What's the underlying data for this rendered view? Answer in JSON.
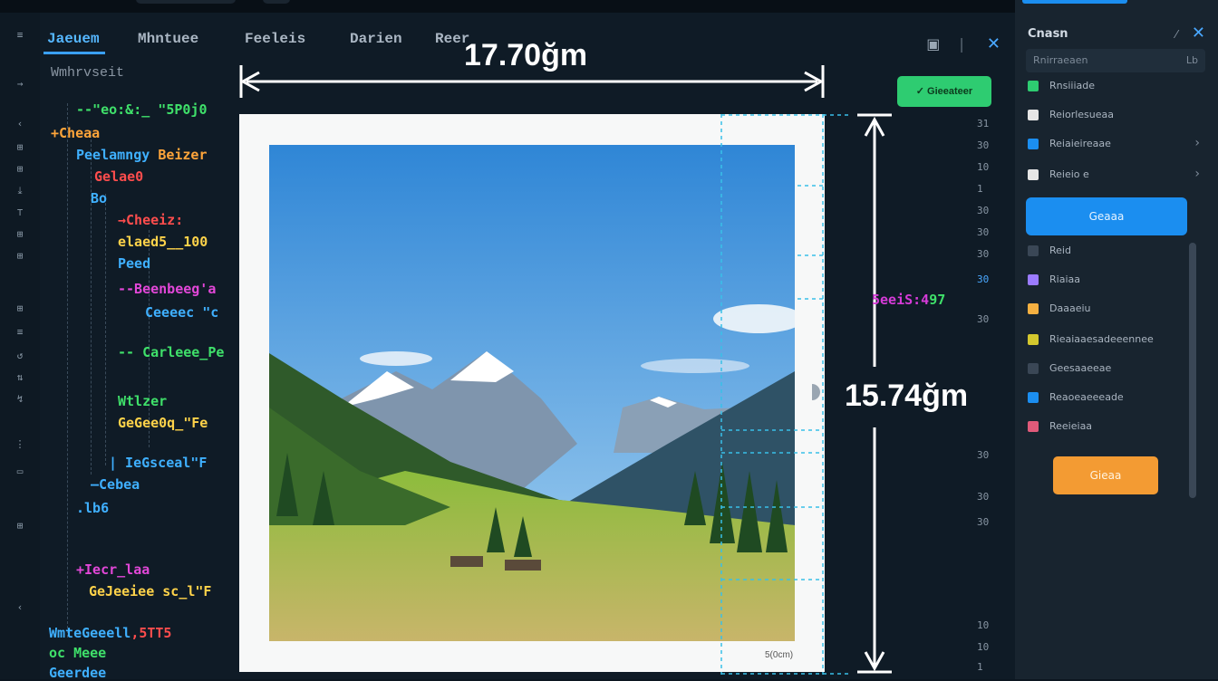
{
  "window": {
    "tabs": [
      {
        "label": "Jaeuem",
        "active": true
      },
      {
        "label": "Mhntuee",
        "active": false
      },
      {
        "label": "Feeleis",
        "active": false
      },
      {
        "label": "Darien",
        "active": false
      },
      {
        "label": "Reer",
        "active": false
      }
    ],
    "breadcrumb": "Wmhrvseit"
  },
  "gutter_icons": [
    "≡",
    "→",
    "‹",
    "⊞",
    "⊞",
    "⤓",
    "⊤",
    "⊞",
    "⊞",
    "⊞",
    "≡",
    "↺",
    "⇅",
    "↯",
    "⋮",
    "▭",
    "⊞",
    "‹"
  ],
  "code": {
    "lines": [
      {
        "text": "--\"eo:&:_ \"5P0j0",
        "color": "#3fe06a"
      },
      {
        "text": "+Cheaa",
        "color": "#ffa53a"
      },
      {
        "text": "Peelamngy ",
        "color": "#3fb0ff",
        "extra": "Beizer",
        "extra_color": "#ffa53a"
      },
      {
        "text": "Gelae0",
        "color": "#ff4d4d"
      },
      {
        "text": "Bo",
        "color": "#3fb0ff"
      },
      {
        "text": "→Cheeiz:",
        "color": "#ff4d4d"
      },
      {
        "text": "elaed5__100",
        "color": "#ffd34a"
      },
      {
        "text": "Peed",
        "color": "#3fb0ff"
      },
      {
        "text": "--Beenbeeg'a",
        "color": "#e247d8"
      },
      {
        "text": "Ceeeec \"c",
        "color": "#3fb0ff"
      },
      {
        "text": "-- Carleee_Pe",
        "color": "#3fe06a"
      },
      {
        "text": "Wtlzer",
        "color": "#3fe06a"
      },
      {
        "text": "GeGee0q_\"Fe",
        "color": "#ffd34a"
      },
      {
        "text": "| IeGsceal\"F",
        "color": "#3fb0ff"
      },
      {
        "text": "—Cebea",
        "color": "#3fb0ff"
      },
      {
        "text": ".lb6",
        "color": "#3fb0ff"
      },
      {
        "text": "+Iecr_laa",
        "color": "#e247d8"
      },
      {
        "text": "GeJeeiee sc_l\"F",
        "color": "#ffd34a"
      },
      {
        "text": "WmteGeeell",
        "color": "#3fb0ff",
        "extra": ",5TT5",
        "extra_color": "#ff4d4d"
      },
      {
        "text": "oc Meee",
        "color": "#3fe06a"
      },
      {
        "text": "Geerdee",
        "color": "#3fb0ff"
      }
    ]
  },
  "measurement": {
    "width_label": "17.70ğm",
    "height_label": "15.74ğm",
    "tag": "5eeiS:4",
    "tag_suffix": "97",
    "caption": "5(0cm)"
  },
  "action_button": "✓ Gieeateer",
  "ruler_numbers": [
    "31",
    "30",
    "10",
    "1",
    "30",
    "30",
    "30",
    "30",
    "30",
    "30",
    "30",
    "30",
    "10",
    "10",
    "1"
  ],
  "right_panel": {
    "title": "Cnasn",
    "search_placeholder": "Rnirraeaen",
    "search_suffix": "Lb",
    "items": [
      {
        "label": "Rnsiiiade",
        "color": "#2ecc71",
        "chevron": false
      },
      {
        "label": "Reiorlesueaa",
        "color": "#e6e6e6",
        "chevron": false
      },
      {
        "label": "Reiaieireaae",
        "color": "#1b8ef0",
        "chevron": true
      },
      {
        "label": "Reieio e",
        "color": "#e6e6e6",
        "chevron": true
      }
    ],
    "primary_button": "Geaaa",
    "items2": [
      {
        "label": "Reid",
        "color": "#3a4756"
      },
      {
        "label": "Riaiaa",
        "color": "#9b7bff"
      },
      {
        "label": "Daaaeiu",
        "color": "#f5b041"
      },
      {
        "label": "Rieaiaaesadeeennee",
        "color": "#d4c82e"
      },
      {
        "label": "Geesaaeeae",
        "color": "#3a4756"
      },
      {
        "label": "Reaoeaeeeade",
        "color": "#1b8ef0"
      },
      {
        "label": "Reeieiaa",
        "color": "#e05a7a"
      }
    ],
    "secondary_button": "Gieaa"
  }
}
